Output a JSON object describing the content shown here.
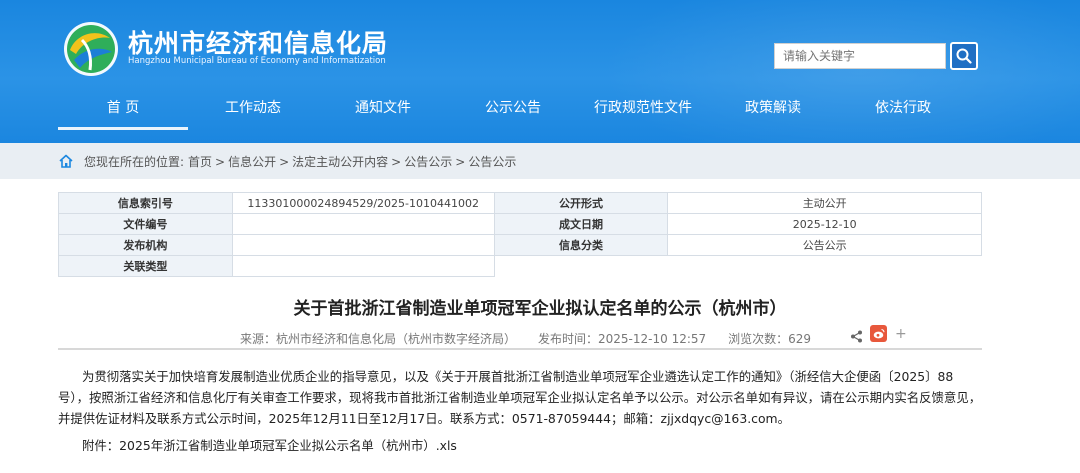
{
  "header": {
    "title": "杭州市经济和信息化局",
    "subtitle": "Hangzhou Municipal Bureau of Economy and Informatization",
    "search_placeholder": "请输入关键字"
  },
  "nav": {
    "items": [
      "首 页",
      "工作动态",
      "通知文件",
      "公示公告",
      "行政规范性文件",
      "政策解读",
      "依法行政"
    ]
  },
  "breadcrumb": {
    "label": "您现在所在的位置:",
    "items": [
      "首页",
      "信息公开",
      "法定主动公开内容",
      "公告公示",
      "公告公示"
    ]
  },
  "meta": {
    "index_label": "信息索引号",
    "index_value": "113301000024894529/2025-1010441002",
    "form_label": "公开形式",
    "form_value": "主动公开",
    "docno_label": "文件编号",
    "docno_value": "",
    "date_label": "成文日期",
    "date_value": "2025-12-10",
    "issuer_label": "发布机构",
    "issuer_value": "",
    "category_label": "信息分类",
    "category_value": "公告公示",
    "relation_label": "关联类型",
    "relation_value": ""
  },
  "article": {
    "title": "关于首批浙江省制造业单项冠军企业拟认定名单的公示（杭州市）",
    "source": "来源：杭州市经济和信息化局（杭州市数字经济局）",
    "published": "发布时间：2025-12-10 12:57",
    "views": "浏览次数：629",
    "body": "为贯彻落实关于加快培育发展制造业优质企业的指导意见，以及《关于开展首批浙江省制造业单项冠军企业遴选认定工作的通知》（浙经信大企便函〔2025〕88号），按照浙江省经济和信息化厅有关审查工作要求，现将我市首批浙江省制造业单项冠军企业拟认定名单予以公示。对公示名单如有异议，请在公示期内实名反馈意见，并提供佐证材料及联系方式公示时间，2025年12月11日至12月17日。联系方式：0571-87059444；邮箱：zjjxdqyc@163.com。",
    "attachment": "附件：2025年浙江省制造业单项冠军企业拟公示名单（杭州市）.xls"
  },
  "colors": {
    "header_blue": "#1b87e0",
    "crumb_bg": "#e9eef3",
    "weibo_red": "#e8583c"
  }
}
